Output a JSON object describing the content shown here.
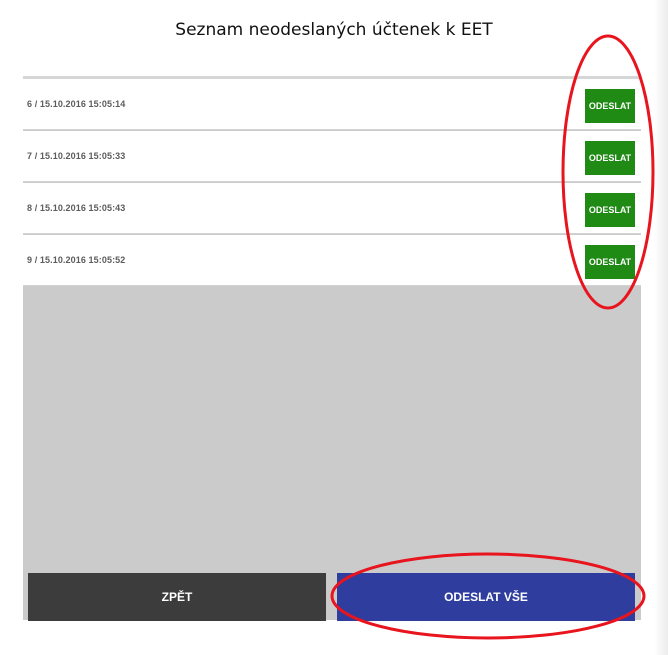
{
  "dialog": {
    "title": "Seznam neodeslaných účtenek k EET"
  },
  "receipts": [
    {
      "label": "6 / 15.10.2016 15:05:14",
      "button": "ODESLAT"
    },
    {
      "label": "7 / 15.10.2016 15:05:33",
      "button": "ODESLAT"
    },
    {
      "label": "8 / 15.10.2016 15:05:43",
      "button": "ODESLAT"
    },
    {
      "label": "9 / 15.10.2016 15:05:52",
      "button": "ODESLAT"
    }
  ],
  "footer": {
    "back_label": "ZPĚT",
    "send_all_label": "ODESLAT VŠE"
  },
  "colors": {
    "send_button": "#1f8a14",
    "back_button": "#3c3c3c",
    "send_all_button": "#2e3d9e",
    "annotation": "#e8141e"
  }
}
